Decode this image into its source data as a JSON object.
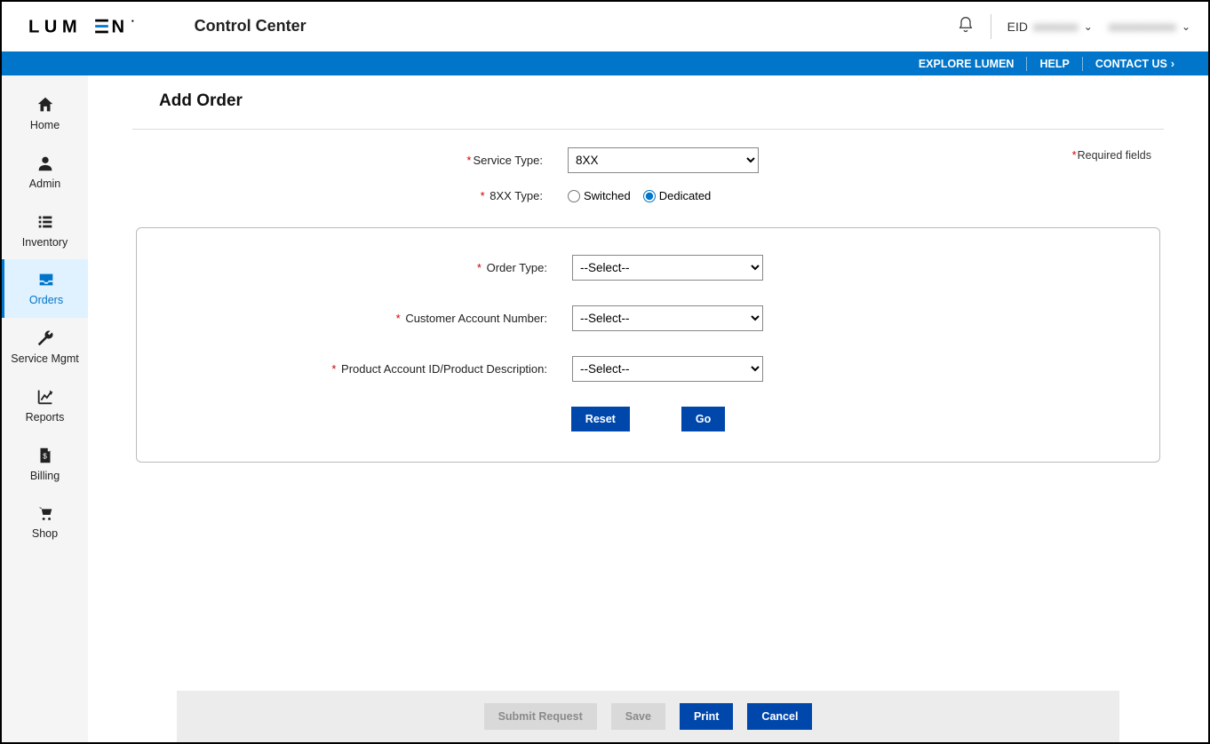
{
  "header": {
    "brand": "LUMEN",
    "app_title": "Control Center",
    "eid_label": "EID",
    "eid_value": "●●●●●●",
    "user_name": "●●●●●●●●●"
  },
  "bluebar": {
    "explore": "EXPLORE LUMEN",
    "help": "HELP",
    "contact": "CONTACT US"
  },
  "sidebar": {
    "items": [
      {
        "label": "Home"
      },
      {
        "label": "Admin"
      },
      {
        "label": "Inventory"
      },
      {
        "label": "Orders"
      },
      {
        "label": "Service Mgmt"
      },
      {
        "label": "Reports"
      },
      {
        "label": "Billing"
      },
      {
        "label": "Shop"
      }
    ]
  },
  "page": {
    "title": "Add Order",
    "required_note": "Required fields"
  },
  "form": {
    "service_type_label": "Service Type:",
    "service_type_value": "8XX",
    "eightxx_type_label": "8XX Type:",
    "radio_switched": "Switched",
    "radio_dedicated": "Dedicated",
    "order_type_label": "Order Type:",
    "order_type_value": "--Select--",
    "customer_account_label": "Customer Account Number:",
    "customer_account_value": "--Select--",
    "product_account_label": "Product Account ID/Product Description:",
    "product_account_value": "--Select--",
    "reset_btn": "Reset",
    "go_btn": "Go"
  },
  "footer": {
    "submit": "Submit Request",
    "save": "Save",
    "print": "Print",
    "cancel": "Cancel"
  }
}
